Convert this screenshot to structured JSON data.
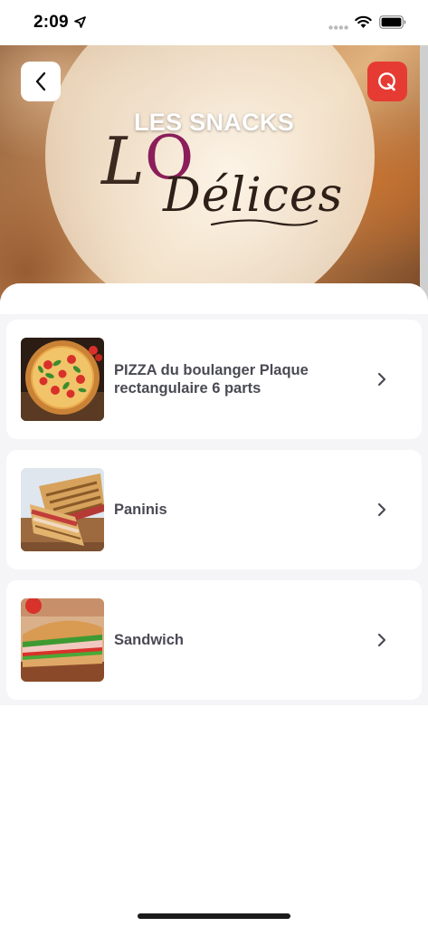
{
  "status_bar": {
    "time": "2:09",
    "icons": [
      "location-arrow-icon",
      "signal-dots-icon",
      "wifi-icon",
      "battery-icon"
    ]
  },
  "header": {
    "title": "LES SNACKS",
    "back_icon": "chevron-left-icon",
    "search_icon": "search-icon"
  },
  "logo": {
    "letter_l": "L",
    "letter_o": "O",
    "text": "Délices"
  },
  "items": [
    {
      "label": "PIZZA du boulanger Plaque rectangulaire 6 parts",
      "thumb": "pizza"
    },
    {
      "label": "Paninis",
      "thumb": "panini"
    },
    {
      "label": "Sandwich",
      "thumb": "sandwich"
    }
  ],
  "colors": {
    "search_accent": "#e63b32",
    "item_text": "#4a4a55",
    "list_bg": "#f5f5f7",
    "logo_o": "#8b1e5a"
  }
}
